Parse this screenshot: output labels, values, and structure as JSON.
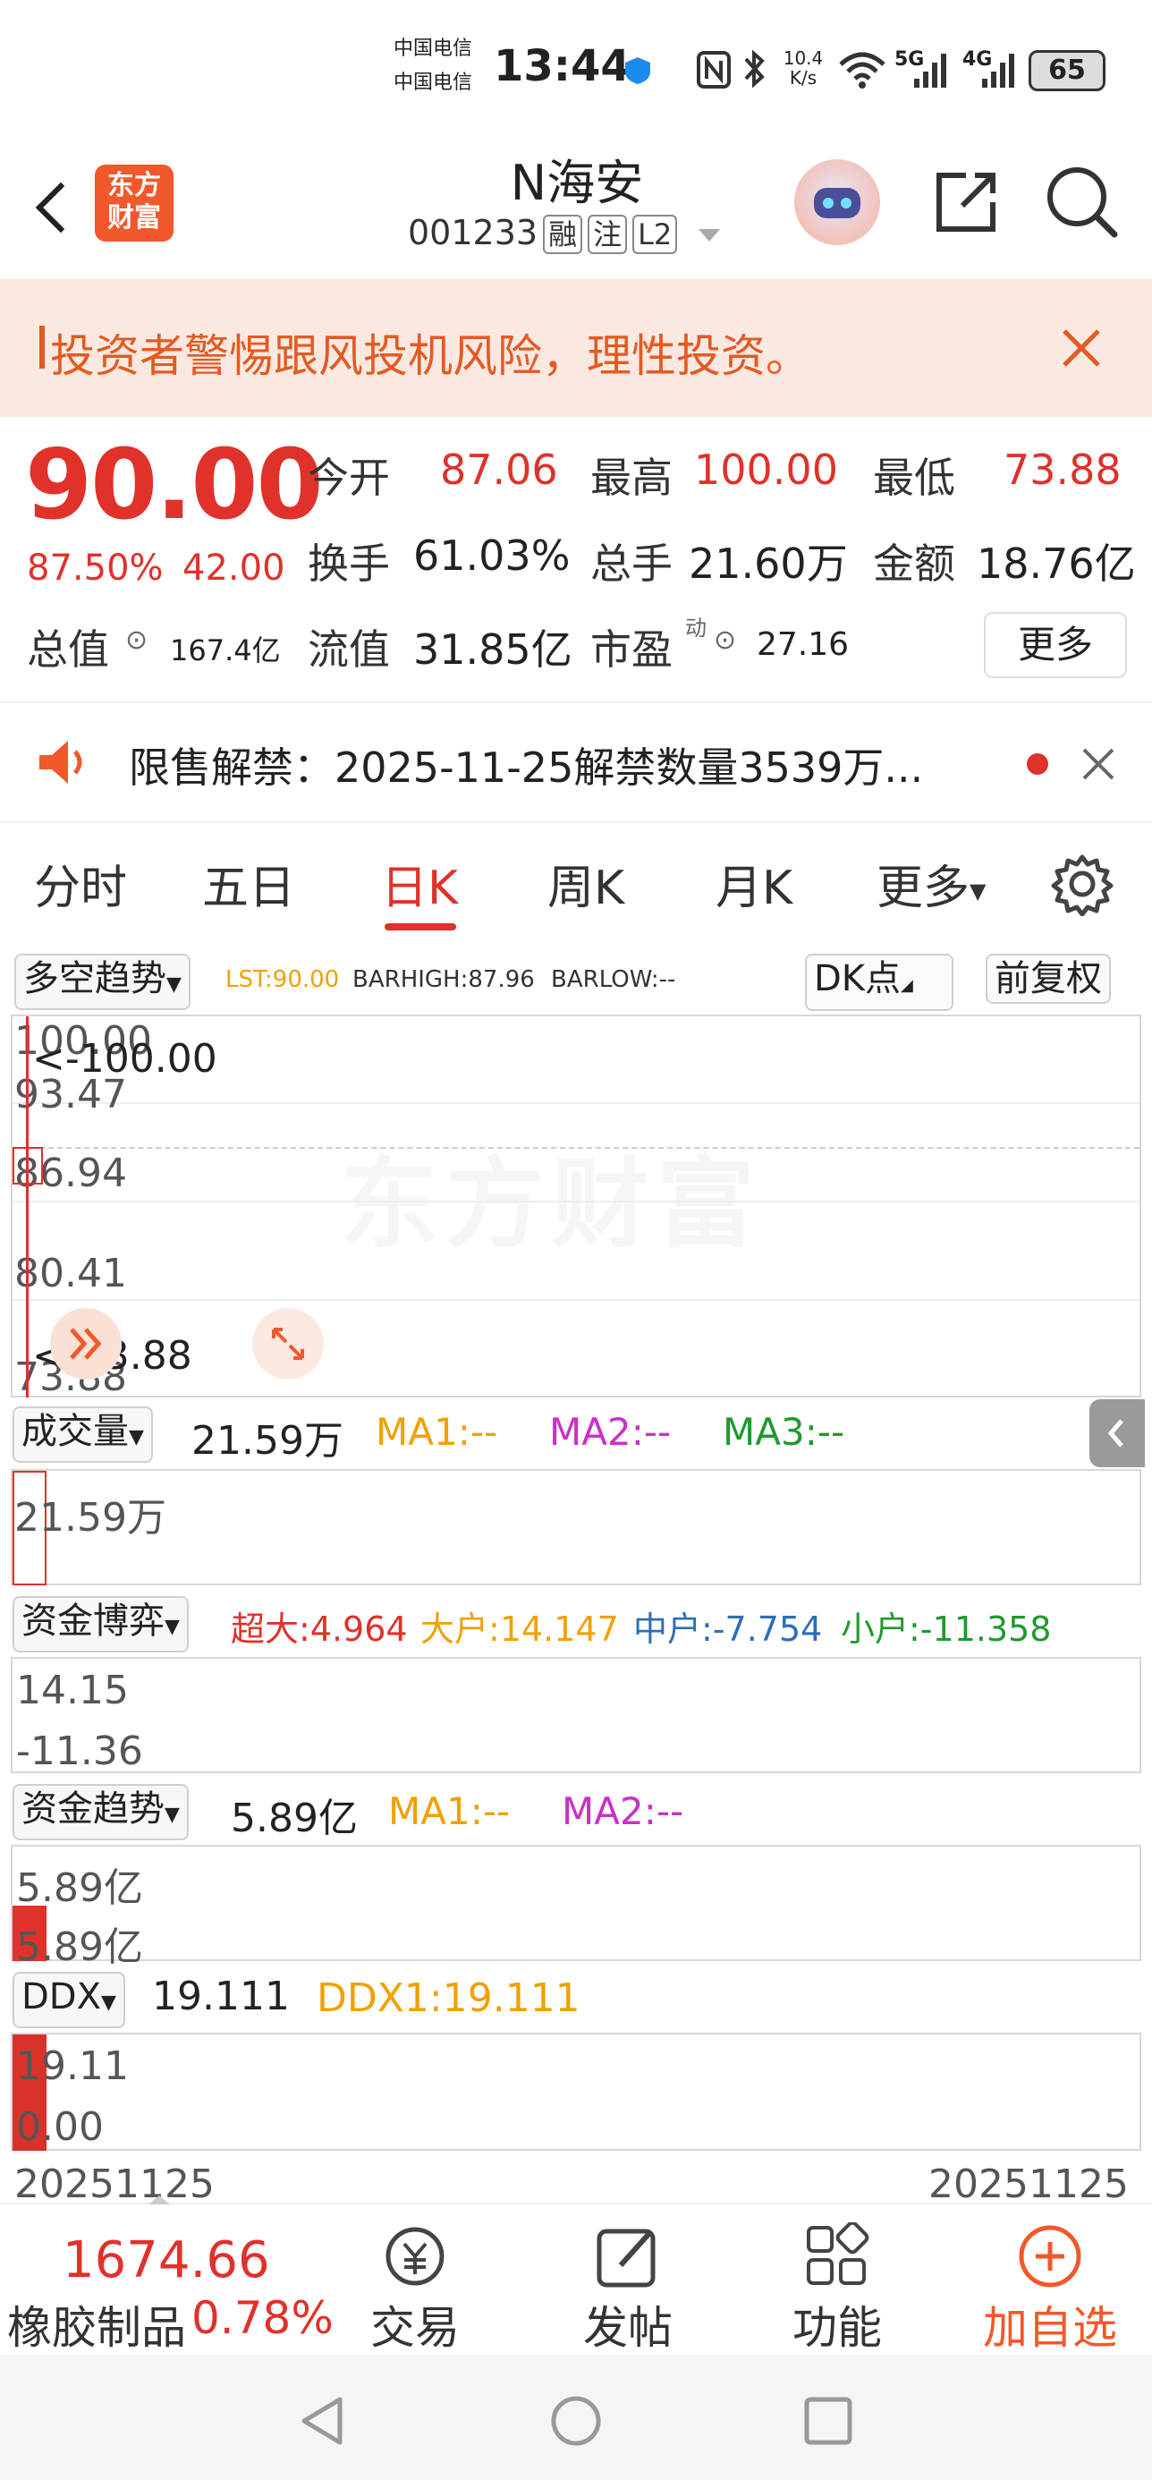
{
  "status_bar": {
    "carrier1": "中国电信",
    "carrier2": "中国电信",
    "time": "13:44",
    "speed_value": "10.4",
    "speed_unit": "K/s",
    "net_5g": "5G",
    "net_4g": "4G",
    "battery": "65"
  },
  "header": {
    "logo_line1": "东方",
    "logo_line2": "财富",
    "stock_name": "N海安",
    "stock_code": "001233",
    "tag_margin": "融",
    "tag_watch": "注",
    "tag_level": "L2"
  },
  "warning": {
    "text": "投资者警惕跟风投机风险，理性投资。"
  },
  "quote": {
    "price": "90.00",
    "change_pct": "87.50%",
    "change_amt": "42.00",
    "open_label": "今开",
    "open_value": "87.06",
    "high_label": "最高",
    "high_value": "100.00",
    "low_label": "最低",
    "low_value": "73.88",
    "turnover_label": "换手",
    "turnover_value": "61.03%",
    "volume_label": "总手",
    "volume_value": "21.60万",
    "amount_label": "金额",
    "amount_value": "18.76亿",
    "mktcap_label": "总值",
    "mktcap_value": "167.4亿",
    "float_label": "流值",
    "float_value": "31.85亿",
    "pe_label": "市盈",
    "pe_sup": "动",
    "pe_value": "27.16",
    "more_label": "更多"
  },
  "notice": {
    "text": "限售解禁：2025-11-25解禁数量3539万..."
  },
  "tabs": [
    {
      "label": "分时"
    },
    {
      "label": "五日"
    },
    {
      "label": "日K"
    },
    {
      "label": "周K"
    },
    {
      "label": "月K"
    },
    {
      "label": "更多"
    }
  ],
  "active_tab": "日K",
  "main_chart": {
    "indicator": "多空趋势",
    "lst": "LST:90.00",
    "barhigh": "BARHIGH:87.96",
    "barlow": "BARLOW:--",
    "dk_label": "DK点",
    "adjust_label": "前复权",
    "y_labels": [
      "100.00",
      "93.47",
      "86.94",
      "80.41",
      "73.88"
    ],
    "high_marker": "<-100.00",
    "low_marker": "<-73.88",
    "watermark": "东方财富"
  },
  "volume_panel": {
    "indicator": "成交量",
    "value": "21.59万",
    "ma1": "MA1:--",
    "ma2": "MA2:--",
    "ma3": "MA3:--",
    "y_label": "21.59万"
  },
  "fund_game_panel": {
    "indicator": "资金博弈",
    "super": "超大:4.964",
    "big": "大户:14.147",
    "mid": "中户:-7.754",
    "small": "小户:-11.358",
    "y_top": "14.15",
    "y_bottom": "-11.36"
  },
  "fund_trend_panel": {
    "indicator": "资金趋势",
    "value": "5.89亿",
    "ma1": "MA1:--",
    "ma2": "MA2:--",
    "y_top": "5.89亿",
    "y_bottom": "5.89亿"
  },
  "ddx_panel": {
    "indicator": "DDX",
    "value": "19.111",
    "ddx1": "DDX1:19.111",
    "y_top": "19.11",
    "y_bottom": "0.00"
  },
  "date_axis": {
    "left": "20251125",
    "right": "20251125"
  },
  "bottom_bar": {
    "index_value": "1674.66",
    "index_name": "橡胶制品",
    "index_change": "0.78%",
    "trade": "交易",
    "post": "发帖",
    "features": "功能",
    "add_watch": "加自选"
  },
  "colors": {
    "up_red": "#e0312a",
    "brand_orange": "#f1582b",
    "warning_bg": "#fbe9e1"
  }
}
